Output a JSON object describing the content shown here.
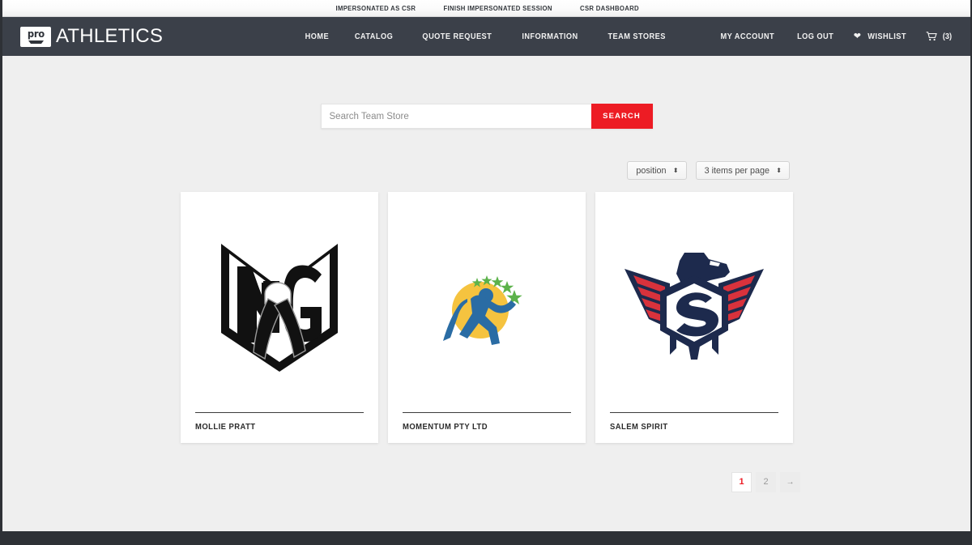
{
  "impersonation_bar": {
    "links": [
      {
        "label": "IMPERSONATED AS CSR"
      },
      {
        "label": "FINISH IMPERSONATED SESSION"
      },
      {
        "label": "CSR DASHBOARD"
      }
    ]
  },
  "header": {
    "brand": {
      "mark_text": "pro",
      "name": "ATHLETICS"
    },
    "nav": [
      {
        "label": "HOME"
      },
      {
        "label": "CATALOG"
      },
      {
        "label": "QUOTE REQUEST"
      },
      {
        "label": "INFORMATION"
      },
      {
        "label": "TEAM STORES"
      }
    ],
    "utility": {
      "my_account": "MY ACCOUNT",
      "log_out": "LOG OUT",
      "wishlist": "WISHLIST",
      "cart_count": "(3)"
    }
  },
  "search": {
    "placeholder": "Search Team Store",
    "value": "",
    "button_label": "SEARCH"
  },
  "toolbar": {
    "sort_by": "position",
    "items_per_page": "3 items per page",
    "caret": "⬍"
  },
  "products": [
    {
      "title": "MOLLIE PRATT",
      "logo": "mg-shield-ribbon-logo"
    },
    {
      "title": "MOMENTUM PTY LTD",
      "logo": "momentum-runner-logo"
    },
    {
      "title": "SALEM SPIRIT",
      "logo": "salem-spirit-eagle-logo"
    }
  ],
  "pagination": {
    "pages": [
      {
        "label": "1",
        "active": true
      },
      {
        "label": "2",
        "active": false
      }
    ],
    "next_label": "→"
  },
  "colors": {
    "accent_red": "#ed1c24",
    "header_dark": "#3b4049",
    "page_background": "#efefef",
    "logo_navy": "#1d2a4d",
    "logo_red": "#d8323c",
    "logo_yellow": "#f5c33f",
    "logo_blue": "#2a6ca4",
    "logo_green": "#5cb24a"
  }
}
